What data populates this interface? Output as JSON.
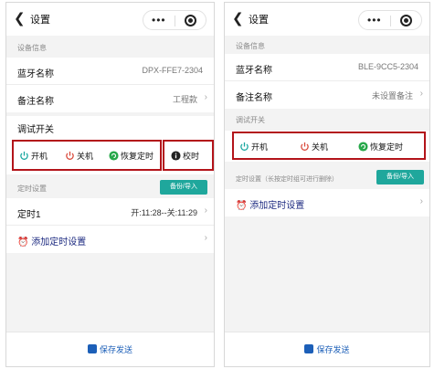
{
  "left": {
    "title": "设置",
    "device_section": "设备信息",
    "bt_label": "蓝牙名称",
    "bt_value": "DPX-FFE7-2304",
    "remark_label": "备注名称",
    "remark_value": "工程款",
    "debug_title": "调试开关",
    "btn_on": "开机",
    "btn_off": "关机",
    "btn_restore": "恢复定时",
    "btn_calib": "校时",
    "timer_section": "定时设置",
    "backup_btn": "备份/导入",
    "timer1_label": "定时1",
    "timer1_value": "开:11:28--关:11:29",
    "add_timer": "添加定时设置",
    "save": "保存发送"
  },
  "right": {
    "title": "设置",
    "device_section": "设备信息",
    "bt_label": "蓝牙名称",
    "bt_value": "BLE-9CC5-2304",
    "remark_label": "备注名称",
    "remark_value": "未设置备注",
    "debug_section": "调试开关",
    "btn_on": "开机",
    "btn_off": "关机",
    "btn_restore": "恢复定时",
    "timer_section": "定时设置（长按定时组可进行删除）",
    "backup_btn": "备份/导入",
    "add_timer": "添加定时设置",
    "save": "保存发送"
  },
  "colors": {
    "power_on": "#1aa7a0",
    "power_off": "#d94a3c",
    "restore": "#27a84a",
    "highlight_box": "#b3141a",
    "teal_button": "#1fa79c",
    "save_blue": "#1c5fb8"
  }
}
